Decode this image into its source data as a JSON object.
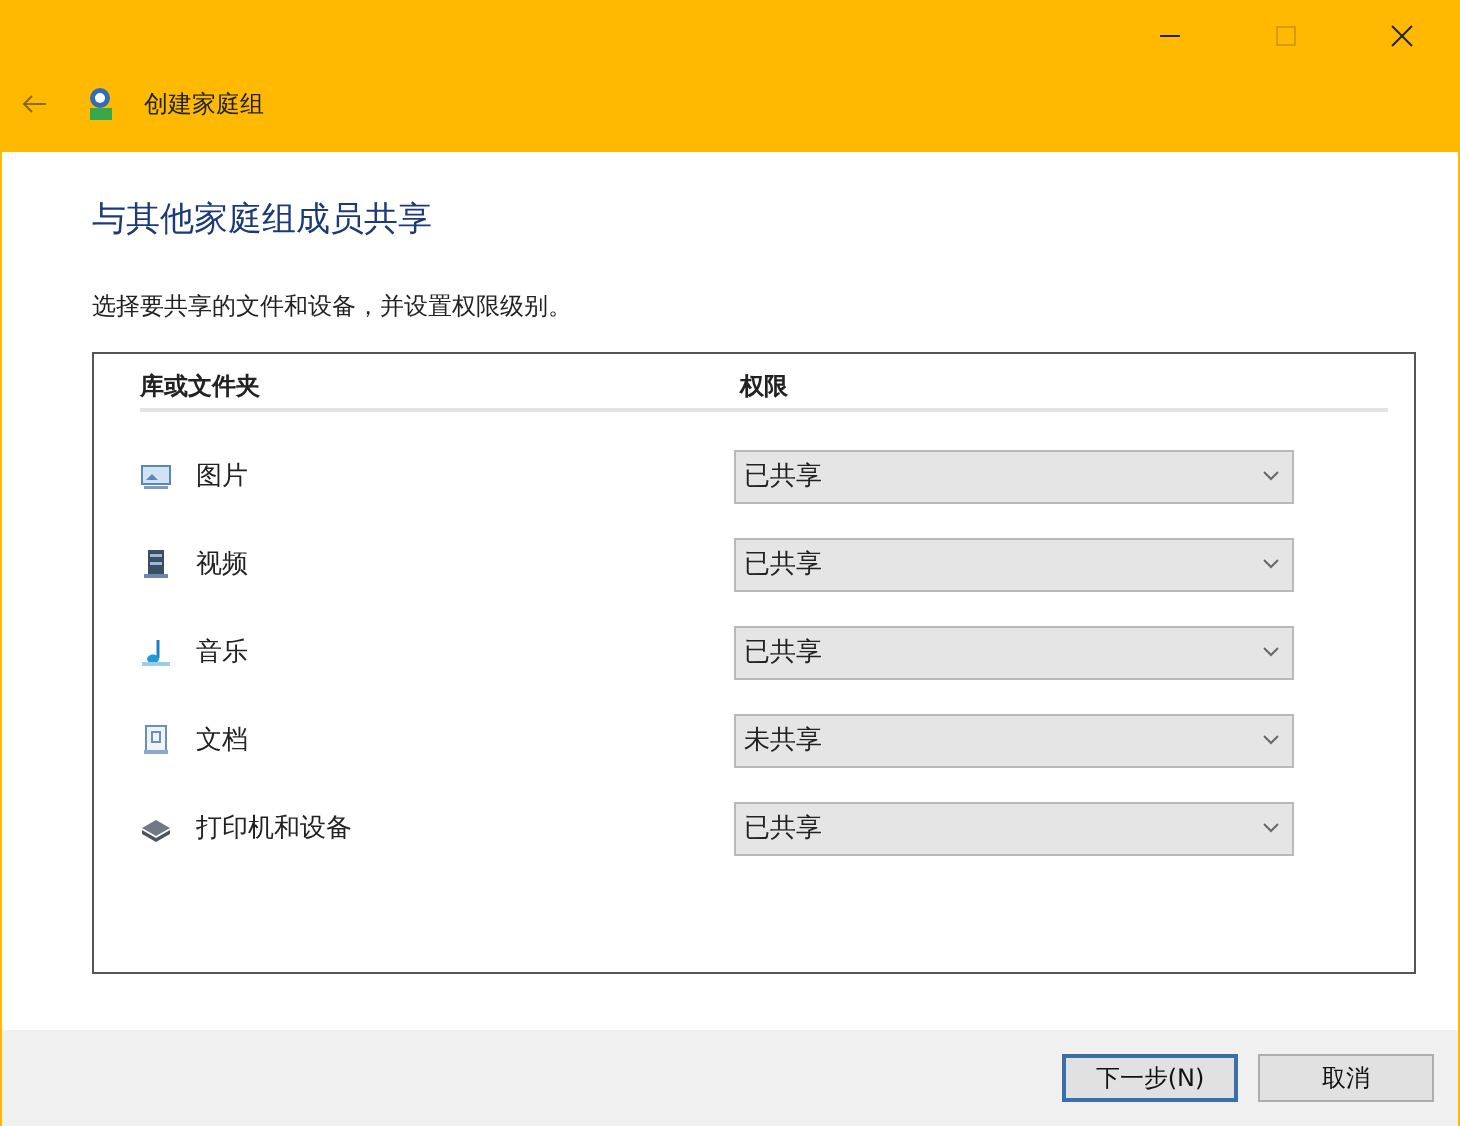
{
  "window": {
    "title": "创建家庭组"
  },
  "heading": "与其他家庭组成员共享",
  "description": "选择要共享的文件和设备，并设置权限级别。",
  "table": {
    "columns": [
      "库或文件夹",
      "权限"
    ],
    "rows": [
      {
        "kind": "pictures",
        "name": "图片",
        "permission": "已共享"
      },
      {
        "kind": "videos",
        "name": "视频",
        "permission": "已共享"
      },
      {
        "kind": "music",
        "name": "音乐",
        "permission": "已共享"
      },
      {
        "kind": "documents",
        "name": "文档",
        "permission": "未共享"
      },
      {
        "kind": "devices",
        "name": "打印机和设备",
        "permission": "已共享"
      }
    ]
  },
  "buttons": [
    {
      "label": "下一步(N)",
      "default": true
    },
    {
      "label": "取消",
      "default": false
    }
  ]
}
